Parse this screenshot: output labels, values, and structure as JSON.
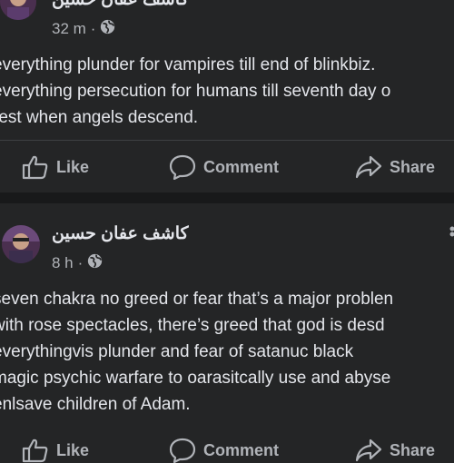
{
  "posts": [
    {
      "author": "كاشف عفان حسين",
      "time": "32 m",
      "separator": "·",
      "privacy_icon": "globe-icon",
      "lines": [
        "everything plunder for vampires till end of blinkbiz.",
        "everything persecution for humans till seventh day o",
        "rest when angels descend."
      ]
    },
    {
      "author": "كاشف عفان حسين",
      "time": "8 h",
      "separator": "·",
      "privacy_icon": "globe-icon",
      "lines": [
        "seven chakra no greed or fear that’s a major problen",
        "with rose spectacles, there’s greed that god is desd",
        "everythingvis plunder and fear of satanuc black",
        "magic psychic warfare to oarasitcally use and abyse",
        "enlsave children of Adam."
      ]
    }
  ],
  "actions": {
    "like": "Like",
    "comment": "Comment",
    "share": "Share"
  },
  "colors": {
    "background": "#242526",
    "separator": "#18191a",
    "text": "#e4e6eb",
    "secondary": "#b0b3b8"
  }
}
